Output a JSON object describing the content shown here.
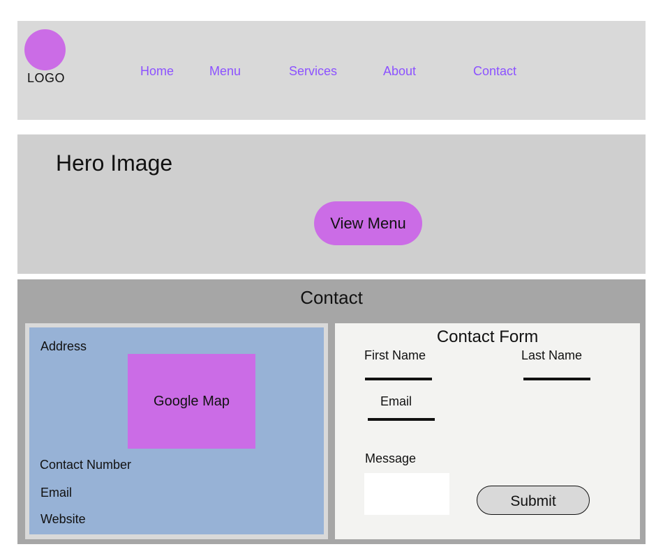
{
  "header": {
    "logo_text": "LOGO",
    "nav": [
      "Home",
      "Menu",
      "Services",
      "About",
      "Contact"
    ]
  },
  "hero": {
    "title": "Hero Image",
    "button_label": "View Menu"
  },
  "contact": {
    "title": "Contact",
    "info": {
      "address_label": "Address",
      "map_label": "Google Map",
      "phone_label": "Contact Number",
      "email_label": "Email",
      "website_label": "Website"
    },
    "form": {
      "title": "Contact Form",
      "first_name_label": "First Name",
      "last_name_label": "Last Name",
      "email_label": "Email",
      "message_label": "Message",
      "submit_label": "Submit"
    }
  },
  "colors": {
    "accent": "#cb6ce6",
    "nav_link": "#8c52ff",
    "header_bg": "#d9d9d9",
    "hero_bg": "#cfcfcf",
    "contact_bg": "#a6a6a6",
    "info_panel_bg": "#97b2d6",
    "form_panel_bg": "#f3f3f1"
  }
}
